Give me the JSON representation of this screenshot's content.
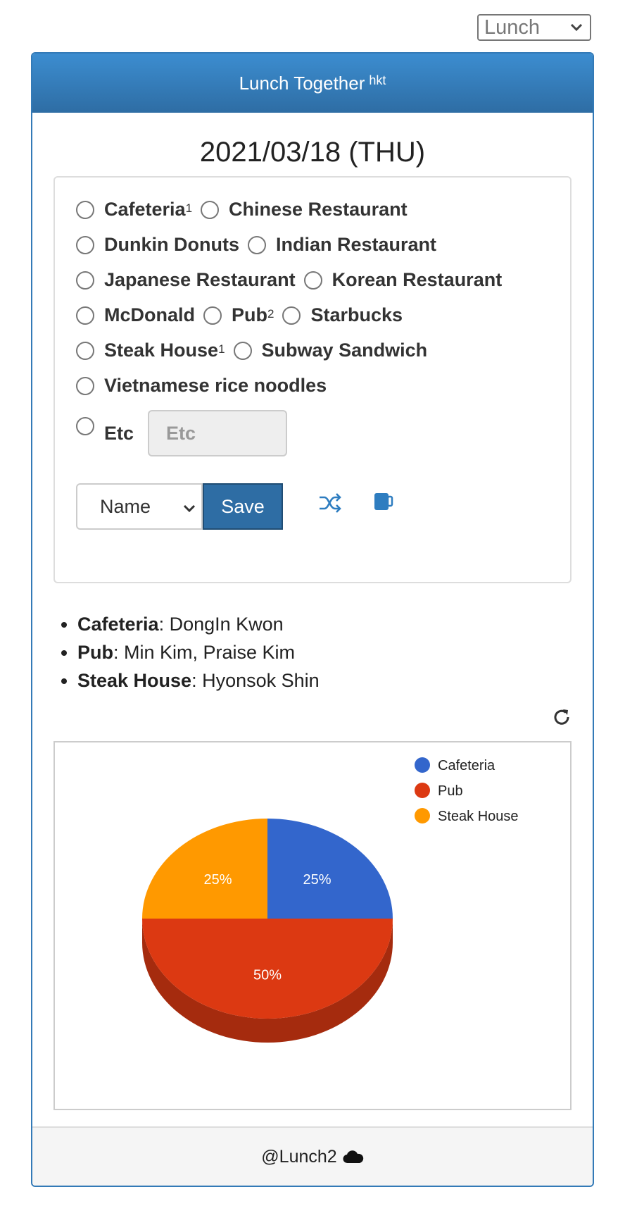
{
  "meal_select": {
    "value": "Lunch"
  },
  "header": {
    "title": "Lunch Together",
    "sup": "hkt"
  },
  "date": "2021/03/18 (THU)",
  "options": {
    "cafeteria": {
      "label": "Cafeteria",
      "count": "1"
    },
    "chinese": {
      "label": "Chinese Restaurant"
    },
    "dunkin": {
      "label": "Dunkin Donuts"
    },
    "indian": {
      "label": "Indian Restaurant"
    },
    "japanese": {
      "label": "Japanese Restaurant"
    },
    "korean": {
      "label": "Korean Restaurant"
    },
    "mcdonald": {
      "label": "McDonald"
    },
    "pub": {
      "label": "Pub",
      "count": "2"
    },
    "starbucks": {
      "label": "Starbucks"
    },
    "steak": {
      "label": "Steak House",
      "count": "1"
    },
    "subway": {
      "label": "Subway Sandwich"
    },
    "vietnamese": {
      "label": "Vietnamese rice noodles"
    },
    "etc": {
      "label": "Etc",
      "placeholder": "Etc"
    }
  },
  "name_select": {
    "value": "Name"
  },
  "save_label": "Save",
  "icons": {
    "shuffle": "shuffle-icon",
    "mug": "mug-icon",
    "refresh": "refresh-icon",
    "cloud": "cloud-icon"
  },
  "summary": [
    {
      "place": "Cafeteria",
      "people": ": DongIn Kwon"
    },
    {
      "place": "Pub",
      "people": ": Min Kim, Praise Kim"
    },
    {
      "place": "Steak House",
      "people": ": Hyonsok Shin"
    }
  ],
  "chart_data": {
    "type": "pie",
    "categories": [
      "Cafeteria",
      "Pub",
      "Steak House"
    ],
    "values": [
      1,
      2,
      1
    ],
    "labels": [
      "25%",
      "50%",
      "25%"
    ],
    "colors": [
      "#3366cc",
      "#dc3912",
      "#ff9900"
    ],
    "legend": "top-right",
    "style": "3d"
  },
  "footer": {
    "text": "@Lunch2"
  }
}
